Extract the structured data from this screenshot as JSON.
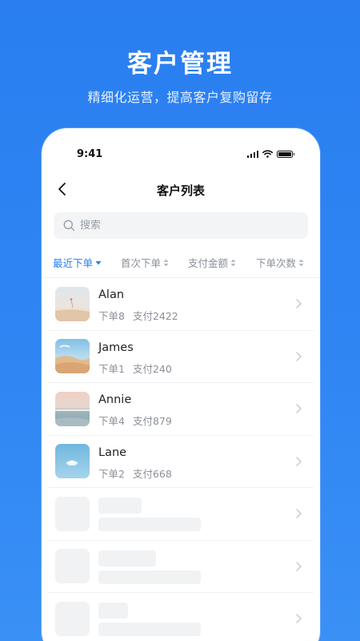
{
  "promo": {
    "title": "客户管理",
    "subtitle": "精细化运营，提高客户复购留存"
  },
  "status_bar": {
    "time": "9:41",
    "icons": [
      "signal-icon",
      "wifi-icon",
      "battery-icon"
    ]
  },
  "nav": {
    "back_icon": "chevron-left-icon",
    "title": "客户列表"
  },
  "search": {
    "placeholder": "搜索",
    "value": "",
    "icon": "search-icon"
  },
  "sort_tabs": [
    {
      "label": "最近下单",
      "active": true
    },
    {
      "label": "首次下单",
      "active": false
    },
    {
      "label": "支付金额",
      "active": false
    },
    {
      "label": "下单次数",
      "active": false
    }
  ],
  "customers": [
    {
      "name": "Alan",
      "orders": "下单8",
      "paid": "支付2422"
    },
    {
      "name": "James",
      "orders": "下单1",
      "paid": "支付240"
    },
    {
      "name": "Annie",
      "orders": "下单4",
      "paid": "支付879"
    },
    {
      "name": "Lane",
      "orders": "下单2",
      "paid": "支付668"
    }
  ],
  "colors": {
    "accent": "#2a7ef0",
    "background": "#2f86f3",
    "muted_text": "#8c9098",
    "skeleton": "#f1f2f4"
  }
}
